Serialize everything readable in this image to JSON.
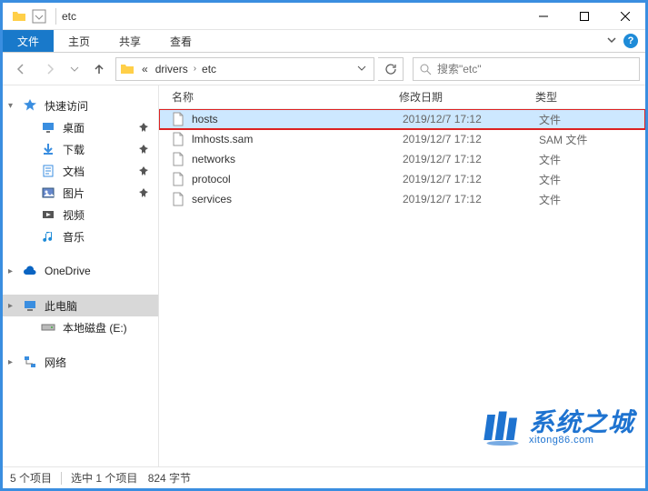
{
  "title": "etc",
  "ribbon": {
    "file": "文件",
    "home": "主页",
    "share": "共享",
    "view": "查看"
  },
  "breadcrumb": {
    "prefix": "«",
    "parts": [
      "drivers",
      "etc"
    ]
  },
  "search": {
    "placeholder": "搜索\"etc\""
  },
  "sidebar": {
    "quick_access": "快速访问",
    "quick_items": [
      {
        "label": "桌面",
        "icon": "desktop",
        "pinned": true
      },
      {
        "label": "下载",
        "icon": "downloads",
        "pinned": true
      },
      {
        "label": "文档",
        "icon": "documents",
        "pinned": true
      },
      {
        "label": "图片",
        "icon": "pictures",
        "pinned": true
      },
      {
        "label": "视频",
        "icon": "videos",
        "pinned": false
      },
      {
        "label": "音乐",
        "icon": "music",
        "pinned": false
      }
    ],
    "onedrive": "OneDrive",
    "this_pc": "此电脑",
    "local_disk": "本地磁盘 (E:)",
    "network": "网络"
  },
  "columns": {
    "name": "名称",
    "date": "修改日期",
    "type": "类型"
  },
  "files": [
    {
      "name": "hosts",
      "date": "2019/12/7 17:12",
      "type": "文件",
      "selected": true,
      "highlighted": true
    },
    {
      "name": "lmhosts.sam",
      "date": "2019/12/7 17:12",
      "type": "SAM 文件",
      "selected": false,
      "highlighted": false
    },
    {
      "name": "networks",
      "date": "2019/12/7 17:12",
      "type": "文件",
      "selected": false,
      "highlighted": false
    },
    {
      "name": "protocol",
      "date": "2019/12/7 17:12",
      "type": "文件",
      "selected": false,
      "highlighted": false
    },
    {
      "name": "services",
      "date": "2019/12/7 17:12",
      "type": "文件",
      "selected": false,
      "highlighted": false
    }
  ],
  "status": {
    "count": "5 个项目",
    "selection": "选中 1 个项目",
    "size": "824 字节"
  },
  "watermark": {
    "cn": "系统之城",
    "en": "xitong86.com"
  }
}
